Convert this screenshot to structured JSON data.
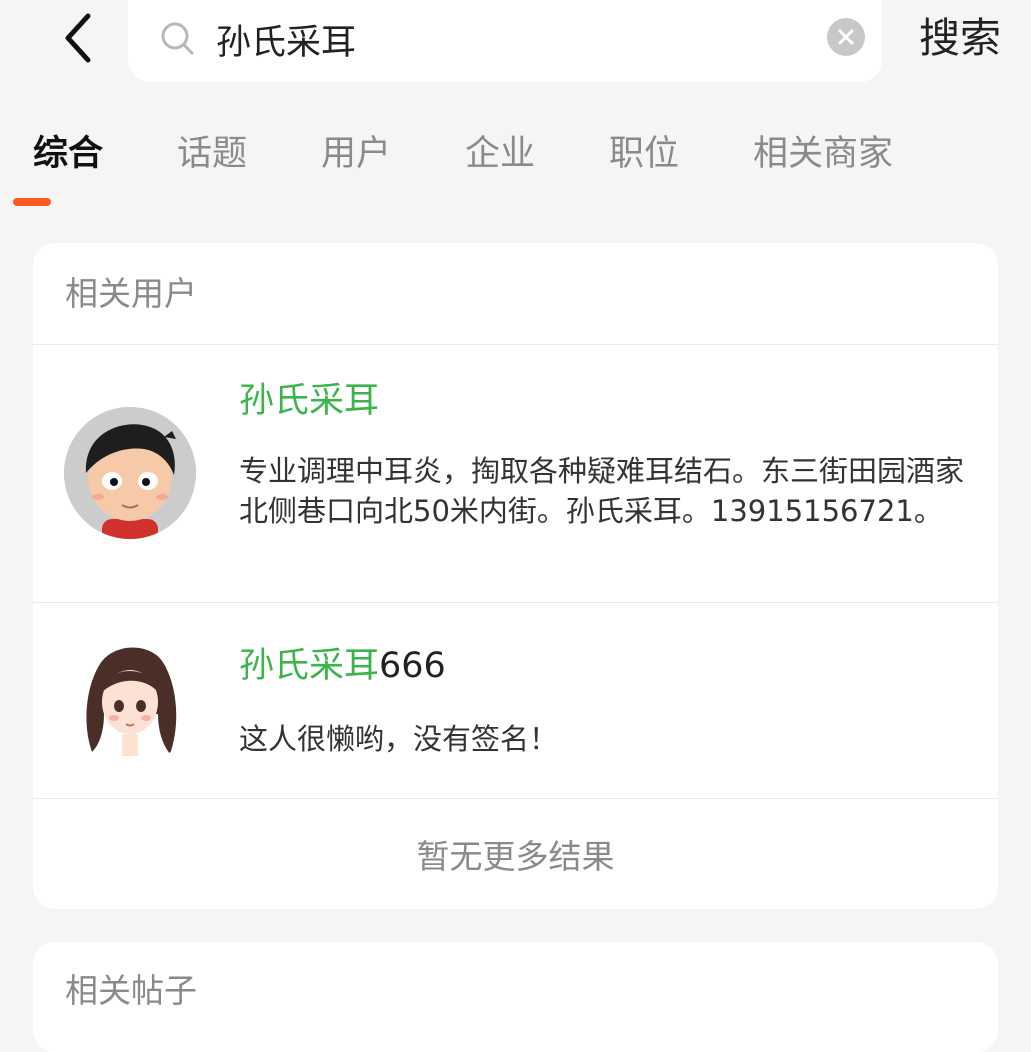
{
  "search": {
    "query": "孙氏采耳",
    "submit_label": "搜索"
  },
  "tabs": [
    {
      "label": "综合",
      "active": true
    },
    {
      "label": "话题",
      "active": false
    },
    {
      "label": "用户",
      "active": false
    },
    {
      "label": "企业",
      "active": false
    },
    {
      "label": "职位",
      "active": false
    },
    {
      "label": "相关商家",
      "active": false
    }
  ],
  "users_section": {
    "title": "相关用户",
    "users": [
      {
        "name_highlight": "孙氏采耳",
        "name_rest": "",
        "bio": "专业调理中耳炎，掏取各种疑难耳结石。东三街田园酒家北侧巷口向北50米内街。孙氏采耳。13915156721。"
      },
      {
        "name_highlight": "孙氏采耳",
        "name_rest": "666",
        "bio": "这人很懒哟，没有签名！"
      }
    ],
    "footer": "暂无更多结果"
  },
  "posts_section": {
    "title": "相关帖子"
  },
  "colors": {
    "accent": "#fa5a1d",
    "highlight": "#3cb44b",
    "background": "#f5f5f5"
  }
}
